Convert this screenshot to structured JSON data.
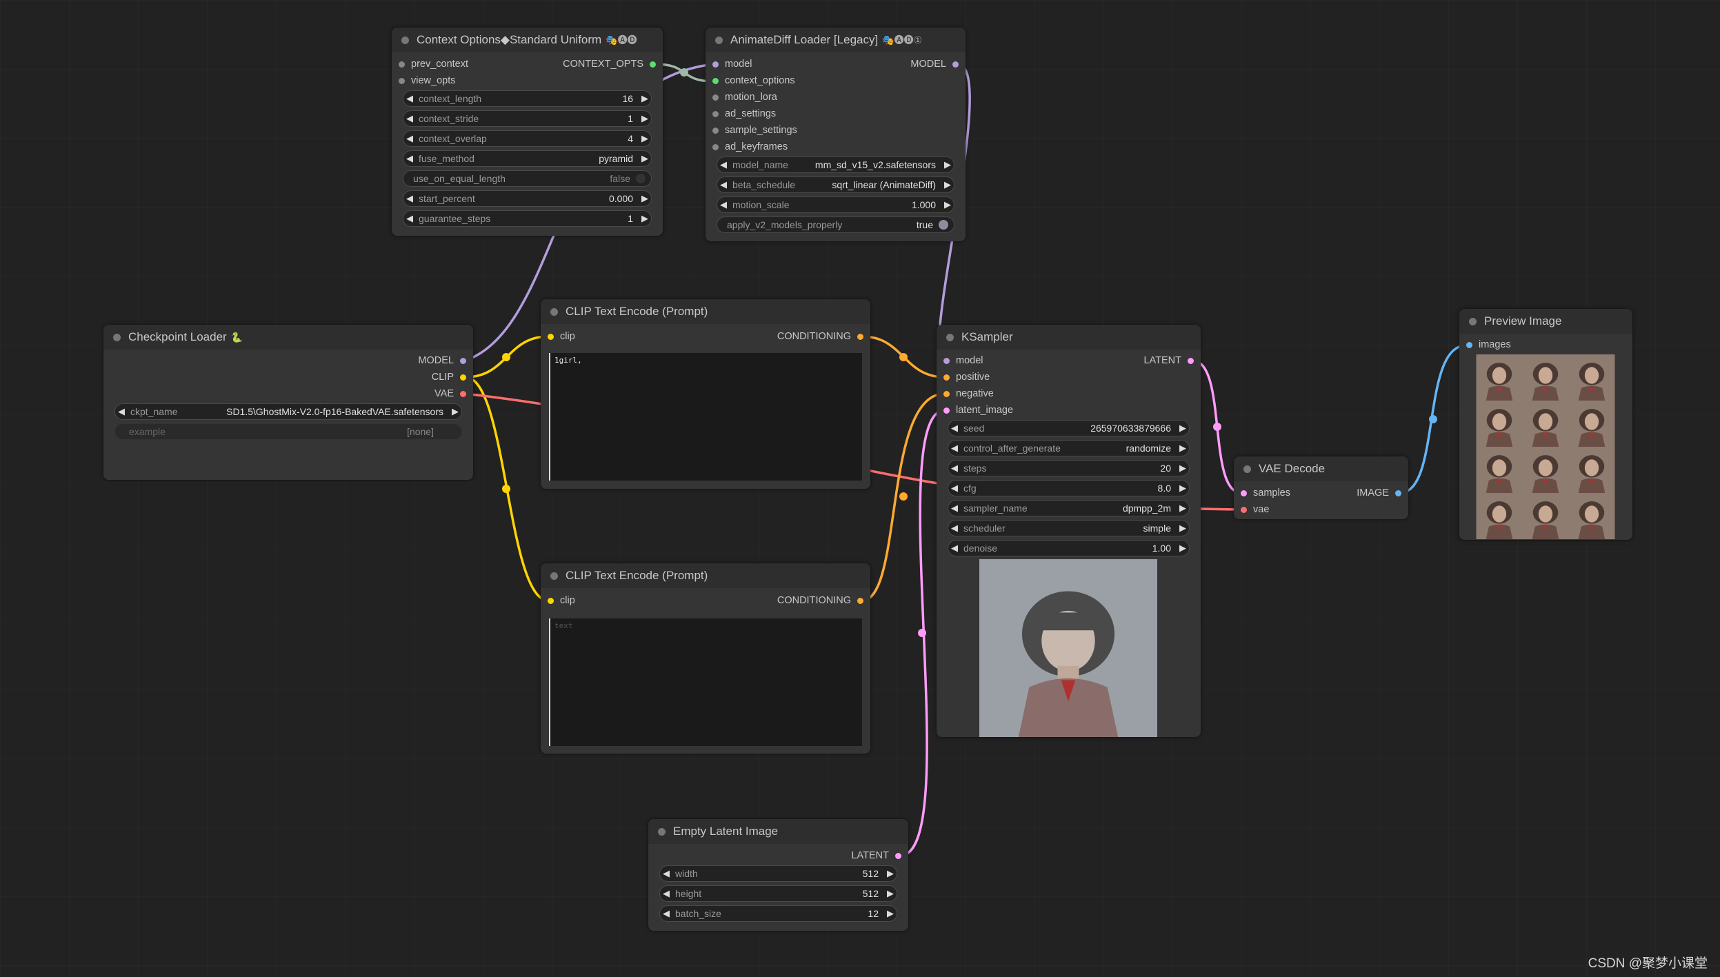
{
  "colors": {
    "background": "#222222",
    "node_body": "#353535",
    "node_title": "#2e2e2e",
    "model_link": "#b39ddb",
    "clip_link": "#ffd500",
    "vae_link": "#ff6e6e",
    "conditioning_link": "#ffa931",
    "latent_link": "#ff9cf9",
    "image_link": "#64b5f6",
    "context_link": "#a0b8a8"
  },
  "nodes": {
    "context_options": {
      "title": "Context Options◆Standard Uniform",
      "badges": [
        "🎭",
        "🅐",
        "🅓"
      ],
      "inputs": [
        "prev_context",
        "view_opts"
      ],
      "output": "CONTEXT_OPTS",
      "widgets": [
        {
          "label": "context_length",
          "value": "16"
        },
        {
          "label": "context_stride",
          "value": "1"
        },
        {
          "label": "context_overlap",
          "value": "4"
        },
        {
          "label": "fuse_method",
          "value": "pyramid"
        },
        {
          "label": "use_on_equal_length",
          "value": "false"
        },
        {
          "label": "start_percent",
          "value": "0.000"
        },
        {
          "label": "guarantee_steps",
          "value": "1"
        }
      ]
    },
    "animatediff_loader": {
      "title": "AnimateDiff Loader [Legacy]",
      "badges": [
        "🎭",
        "🅐",
        "🅓",
        "①"
      ],
      "inputs": [
        "model",
        "context_options",
        "motion_lora",
        "ad_settings",
        "sample_settings",
        "ad_keyframes"
      ],
      "output": "MODEL",
      "widgets": [
        {
          "label": "model_name",
          "value": "mm_sd_v15_v2.safetensors"
        },
        {
          "label": "beta_schedule",
          "value": "sqrt_linear (AnimateDiff)"
        },
        {
          "label": "motion_scale",
          "value": "1.000"
        },
        {
          "label": "apply_v2_models_properly",
          "value": "true"
        }
      ]
    },
    "checkpoint_loader": {
      "title": "Checkpoint Loader",
      "badge": "🐍",
      "outputs": [
        "MODEL",
        "CLIP",
        "VAE"
      ],
      "widgets": [
        {
          "label": "ckpt_name",
          "value": "SD1.5\\GhostMix-V2.0-fp16-BakedVAE.safetensors"
        },
        {
          "label": "example",
          "value": "[none]"
        }
      ]
    },
    "clip_encode_pos": {
      "title": "CLIP Text Encode (Prompt)",
      "input": "clip",
      "output": "CONDITIONING",
      "text": "1girl,"
    },
    "clip_encode_neg": {
      "title": "CLIP Text Encode (Prompt)",
      "input": "clip",
      "output": "CONDITIONING",
      "placeholder": "text"
    },
    "ksampler": {
      "title": "KSampler",
      "inputs": [
        "model",
        "positive",
        "negative",
        "latent_image"
      ],
      "output": "LATENT",
      "widgets": [
        {
          "label": "seed",
          "value": "265970633879666"
        },
        {
          "label": "control_after_generate",
          "value": "randomize"
        },
        {
          "label": "steps",
          "value": "20"
        },
        {
          "label": "cfg",
          "value": "8.0"
        },
        {
          "label": "sampler_name",
          "value": "dpmpp_2m"
        },
        {
          "label": "scheduler",
          "value": "simple"
        },
        {
          "label": "denoise",
          "value": "1.00"
        }
      ]
    },
    "vae_decode": {
      "title": "VAE Decode",
      "inputs": [
        "samples",
        "vae"
      ],
      "output": "IMAGE"
    },
    "preview_image": {
      "title": "Preview Image",
      "input": "images"
    },
    "empty_latent": {
      "title": "Empty Latent Image",
      "output": "LATENT",
      "widgets": [
        {
          "label": "width",
          "value": "512"
        },
        {
          "label": "height",
          "value": "512"
        },
        {
          "label": "batch_size",
          "value": "12"
        }
      ]
    }
  },
  "watermark": "CSDN @聚梦小课堂"
}
